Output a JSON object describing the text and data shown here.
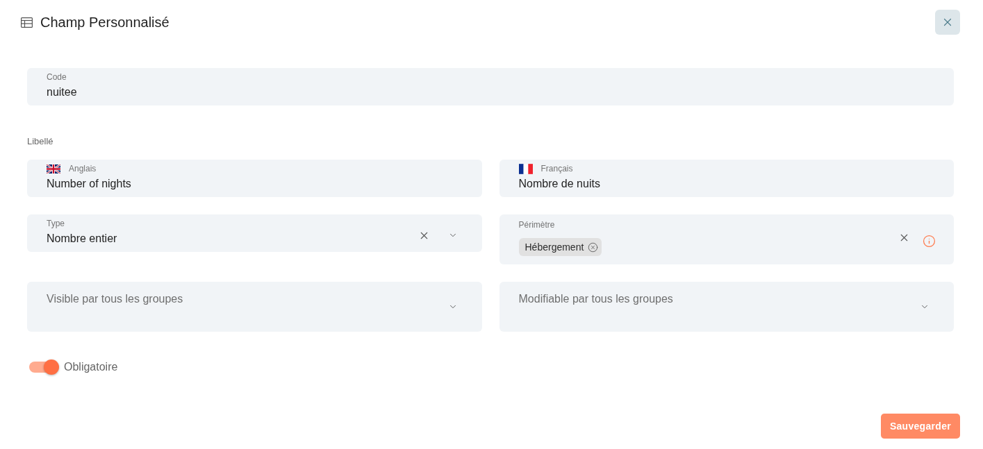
{
  "dialog": {
    "title": "Champ Personnalisé"
  },
  "code_field": {
    "label": "Code",
    "value": "nuitee"
  },
  "libelle": {
    "label": "Libellé",
    "translations": [
      {
        "language": "Anglais",
        "kind": "uk",
        "value": "Number of nights"
      },
      {
        "language": "Français",
        "kind": "fr",
        "value": "Nombre de nuits"
      }
    ]
  },
  "type_field": {
    "label": "Type",
    "value": "Nombre entier"
  },
  "perimetre_field": {
    "label": "Périmètre",
    "chips": [
      "Hébergement"
    ]
  },
  "group_selects": [
    {
      "placeholder": "Visible par tous les groupes"
    },
    {
      "placeholder": "Modifiable par tous les groupes"
    }
  ],
  "obligatoire": {
    "label": "Obligatoire",
    "on": true
  },
  "buttons": [
    "Sauvegarder"
  ]
}
